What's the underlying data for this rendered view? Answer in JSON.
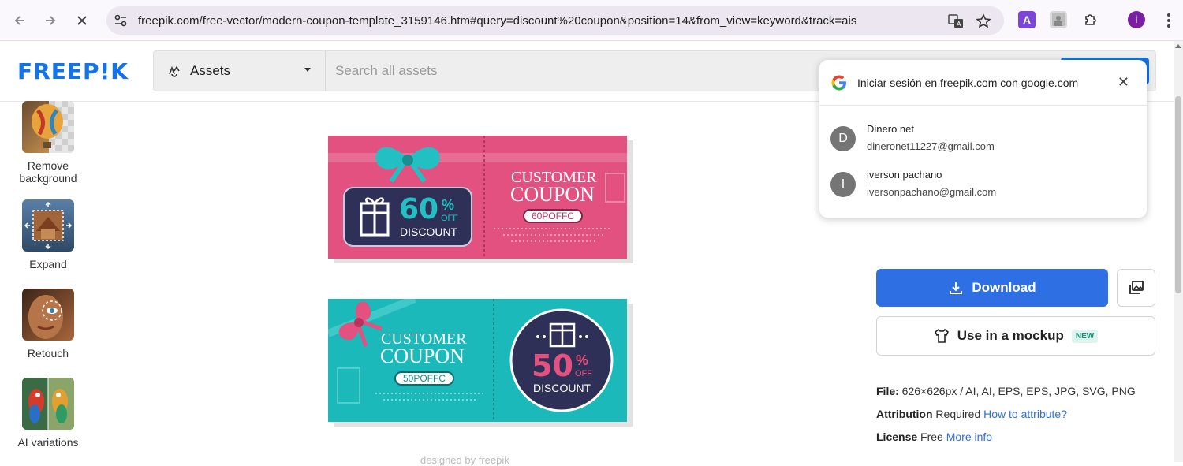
{
  "browser": {
    "url": "freepik.com/free-vector/modern-coupon-template_3159146.htm#query=discount%20coupon&position=14&from_view=keyword&track=ais",
    "profile_initial": "i"
  },
  "header": {
    "logo": "FREEP!K",
    "assets_label": "Assets",
    "search_placeholder": "Search all assets"
  },
  "sidebar": {
    "tools": [
      {
        "label": "Remove background"
      },
      {
        "label": "Expand"
      },
      {
        "label": "Retouch"
      },
      {
        "label": "AI variations"
      }
    ]
  },
  "coupons": {
    "pink": {
      "title1": "CUSTOMER",
      "title2": "COUPON",
      "code": "60POFFC",
      "percent": "60",
      "pct_sign": "%",
      "off": "OFF",
      "discount": "DISCOUNT"
    },
    "teal": {
      "title1": "CUSTOMER",
      "title2": "COUPON",
      "code": "50POFFC",
      "percent": "50",
      "pct_sign": "%",
      "off": "OFF",
      "discount": "DISCOUNT"
    },
    "designed_by": "designed by freepik"
  },
  "signin_popup": {
    "title": "Iniciar sesión en freepik.com con google.com",
    "accounts": [
      {
        "initial": "D",
        "name": "Dinero net",
        "email": "dineronet11227@gmail.com"
      },
      {
        "initial": "I",
        "name": "iverson pachano",
        "email": "iversonpachano@gmail.com"
      }
    ]
  },
  "details": {
    "download_label": "Download",
    "mockup_label": "Use in a mockup",
    "new_badge": "NEW",
    "file_label": "File:",
    "file_value": "626×626px / AI, AI, EPS, EPS, JPG, SVG, PNG",
    "attribution_label": "Attribution",
    "attribution_value": "Required",
    "attribution_link": "How to attribute?",
    "license_label": "License",
    "license_value": "Free",
    "license_link": "More info"
  },
  "colors": {
    "brand_blue": "#1273eb",
    "download_blue": "#2f6fe4",
    "coupon_pink": "#e2517f",
    "coupon_teal": "#1bb9b9",
    "coupon_navy": "#2f3057"
  }
}
